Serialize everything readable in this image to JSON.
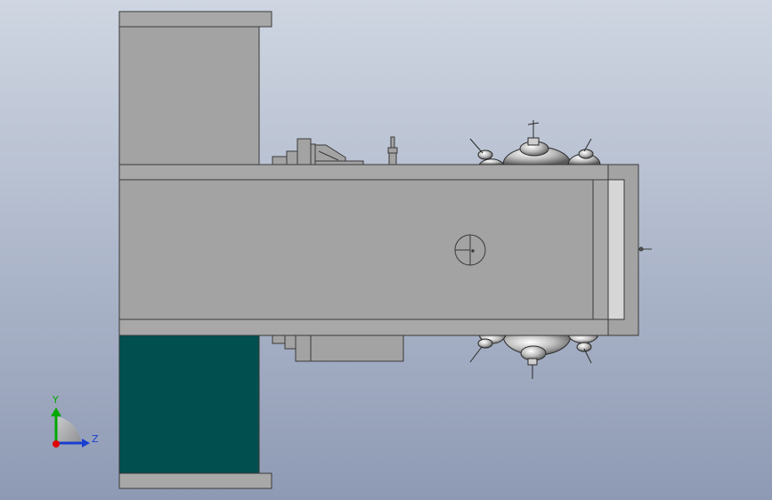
{
  "viewport": {
    "background_top": "#cfd6e2",
    "background_bottom": "#8e9ab4"
  },
  "colors": {
    "body_gray": "#a3a3a3",
    "plate_gray": "#a8a8a8",
    "outline": "#3a3a3a",
    "dark_teal": "#024f4f",
    "light_strip": "#d6d6d6",
    "chrome_light": "#f2f2f2",
    "chrome_dark": "#555555",
    "axis_x": "#e00000",
    "axis_y": "#00a800",
    "axis_z": "#1a3fd0"
  },
  "triad": {
    "y_label": "Y",
    "z_label": "Z",
    "icon": "coordinate-triad-icon"
  }
}
